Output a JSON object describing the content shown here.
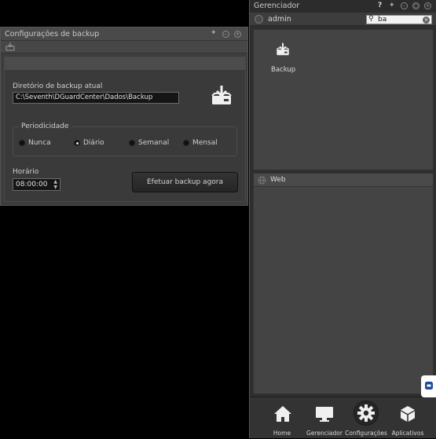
{
  "backup_window": {
    "title": "Configurações de backup",
    "directory_label": "Diretório de backup atual",
    "directory_value": "C:\\Seventh\\DGuardCenter\\Dados\\Backup",
    "period_label": "Periodicidade",
    "options": [
      "Nunca",
      "Diário",
      "Semanal",
      "Mensal"
    ],
    "selected_option": "Diário",
    "time_label": "Horário",
    "time_value": "08:00:00",
    "backup_button": "Efetuar backup agora"
  },
  "manager": {
    "title": "Gerenciador",
    "help": "?",
    "user": "admin",
    "search_value": "ba",
    "items": [
      {
        "label": "Backup",
        "icon": "backup-drive-icon"
      }
    ],
    "section": "Web"
  },
  "nav": [
    {
      "label": "Home",
      "icon": "home-icon"
    },
    {
      "label": "Gerenciador",
      "icon": "monitor-icon"
    },
    {
      "label": "Configurações",
      "icon": "gear-icon"
    },
    {
      "label": "Aplicativos",
      "icon": "cube-icon"
    }
  ],
  "colors": {
    "background": "#000000",
    "panel": "#3d3d3d",
    "accent": "#d8d8d8"
  }
}
